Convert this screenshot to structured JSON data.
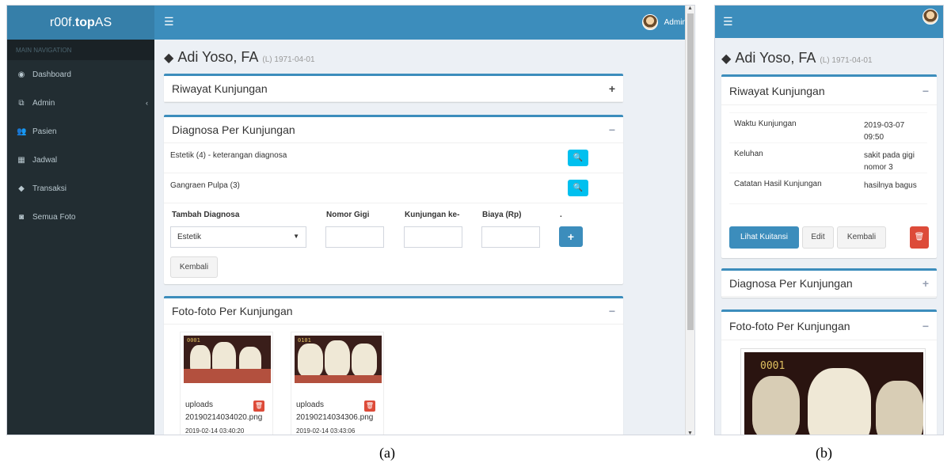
{
  "screen_a": {
    "brand_prefix": "r00f.",
    "brand_bold": "top",
    "brand_suffix": "AS",
    "menu_icon": "☰",
    "user_name": "Admin",
    "sidebar": {
      "header": "MAIN NAVIGATION",
      "items": [
        {
          "label": "Dashboard",
          "icon": "dashboard-icon",
          "glyph": "◉"
        },
        {
          "label": "Admin",
          "icon": "admin-icon",
          "glyph": "⧉"
        },
        {
          "label": "Pasien",
          "icon": "users-icon",
          "glyph": "👥"
        },
        {
          "label": "Jadwal",
          "icon": "calendar-icon",
          "glyph": "▦"
        },
        {
          "label": "Transaksi",
          "icon": "tag-icon",
          "glyph": "◆"
        },
        {
          "label": "Semua Foto",
          "icon": "camera-icon",
          "glyph": "◙"
        }
      ],
      "caret": "‹"
    },
    "patient": {
      "name": "Adi Yoso, FA",
      "info": "(L) 1971-04-01",
      "icon": "tag-icon"
    },
    "riwayat": {
      "title": "Riwayat Kunjungan",
      "toggle": "+"
    },
    "diagnosa": {
      "title": "Diagnosa Per Kunjungan",
      "toggle": "−",
      "rows": [
        "Estetik (4) - keterangan diagnosa",
        "Gangraen Pulpa (3)"
      ],
      "search_glyph": "🔍",
      "form": {
        "label_diagnosa": "Tambah Diagnosa",
        "label_gigi": "Nomor Gigi",
        "label_kunjungan": "Kunjungan ke-",
        "label_biaya": "Biaya (Rp)",
        "label_dot": ".",
        "select_value": "Estetik",
        "caret": "▼",
        "plus": "+",
        "back": "Kembali"
      }
    },
    "foto": {
      "title": "Foto-foto Per Kunjungan",
      "toggle": "−",
      "photos": [
        {
          "folder": "uploads",
          "file": "20190214034020.png",
          "date": "2019-02-14 03:40:20",
          "overlay": "0001"
        },
        {
          "folder": "uploads",
          "file": "20190214034306.png",
          "date": "2019-02-14 03:43:06",
          "overlay": "0101"
        }
      ],
      "trash_glyph": "🗑"
    }
  },
  "screen_b": {
    "menu_icon": "☰",
    "patient": {
      "name": "Adi Yoso, FA",
      "info": "(L) 1971-04-01"
    },
    "riwayat": {
      "title": "Riwayat Kunjungan",
      "toggle": "−",
      "rows": [
        {
          "key": "Waktu Kunjungan",
          "value": "2019-03-07 09:50"
        },
        {
          "key": "Keluhan",
          "value": "sakit pada gigi nomor 3"
        },
        {
          "key": "Catatan Hasil Kunjungan",
          "value": "hasilnya bagus"
        }
      ],
      "btn_kuitansi": "Lihat Kuitansi",
      "btn_edit": "Edit",
      "btn_kembali": "Kembali",
      "trash_glyph": "🗑"
    },
    "diagnosa": {
      "title": "Diagnosa Per Kunjungan",
      "toggle": "+"
    },
    "foto": {
      "title": "Foto-foto Per Kunjungan",
      "toggle": "−",
      "overlay": "0001"
    }
  },
  "captions": {
    "a": "(a)",
    "b": "(b)"
  },
  "colors": {
    "primary": "#3c8dbc",
    "sidebar": "#222d32",
    "info": "#00c0ef",
    "danger": "#dd4b39"
  }
}
